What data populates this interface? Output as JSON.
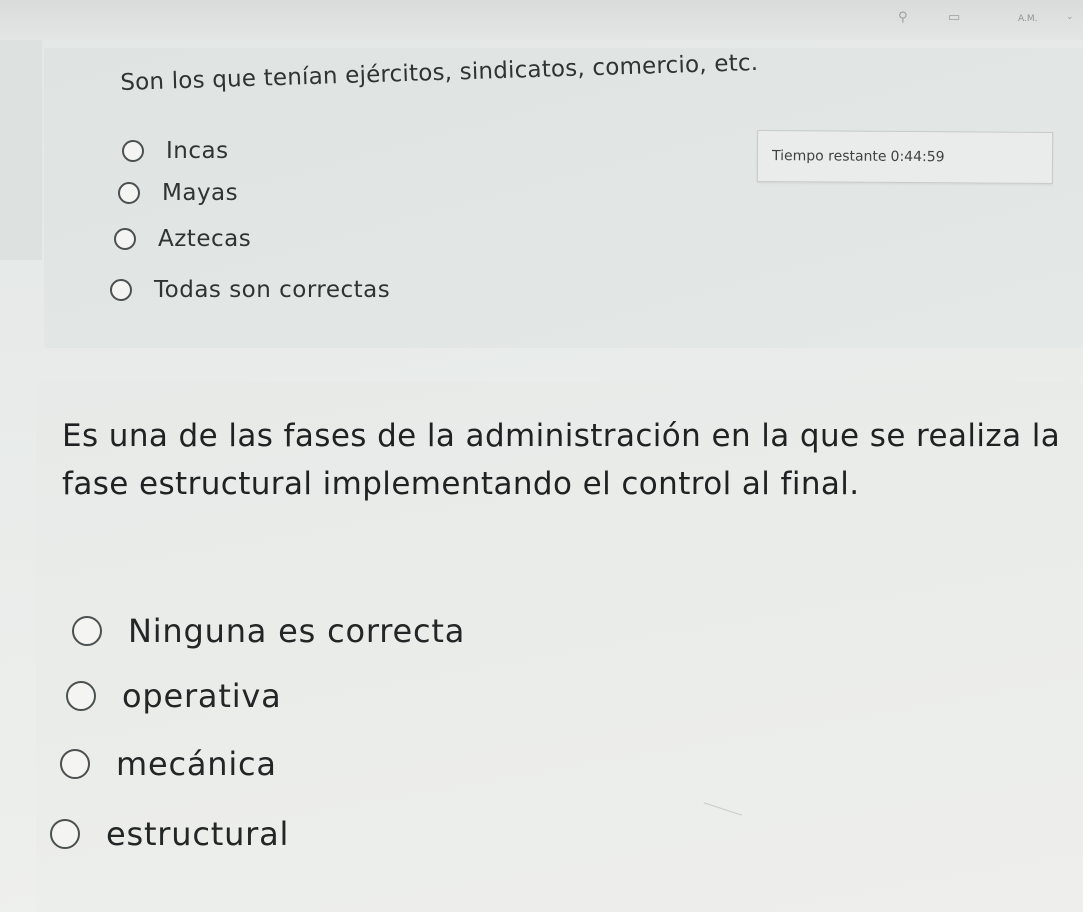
{
  "header": {
    "user_name": "A.M.",
    "icons": [
      "search-icon",
      "window-icon",
      "chevron-down-icon"
    ]
  },
  "question1": {
    "prompt": "Son los que tenían ejércitos, sindicatos, comercio, etc.",
    "options": [
      {
        "label": "Incas",
        "selected": false
      },
      {
        "label": "Mayas",
        "selected": false
      },
      {
        "label": "Aztecas",
        "selected": false
      },
      {
        "label": "Todas son correctas",
        "selected": false
      }
    ]
  },
  "timer": {
    "label": "Tiempo restante",
    "value": "0:44:59"
  },
  "question2": {
    "prompt": "Es una de las fases de la administración en la que se realiza la fase estructural implementando el control al final.",
    "options": [
      {
        "label": "Ninguna es correcta",
        "selected": false
      },
      {
        "label": "operativa",
        "selected": false
      },
      {
        "label": "mecánica",
        "selected": false
      },
      {
        "label": "estructural",
        "selected": false
      }
    ]
  },
  "colors": {
    "background": "#e9ecea",
    "card": "#e2e6e4",
    "text": "#2a2d2d",
    "radio_border": "#4b5050"
  }
}
